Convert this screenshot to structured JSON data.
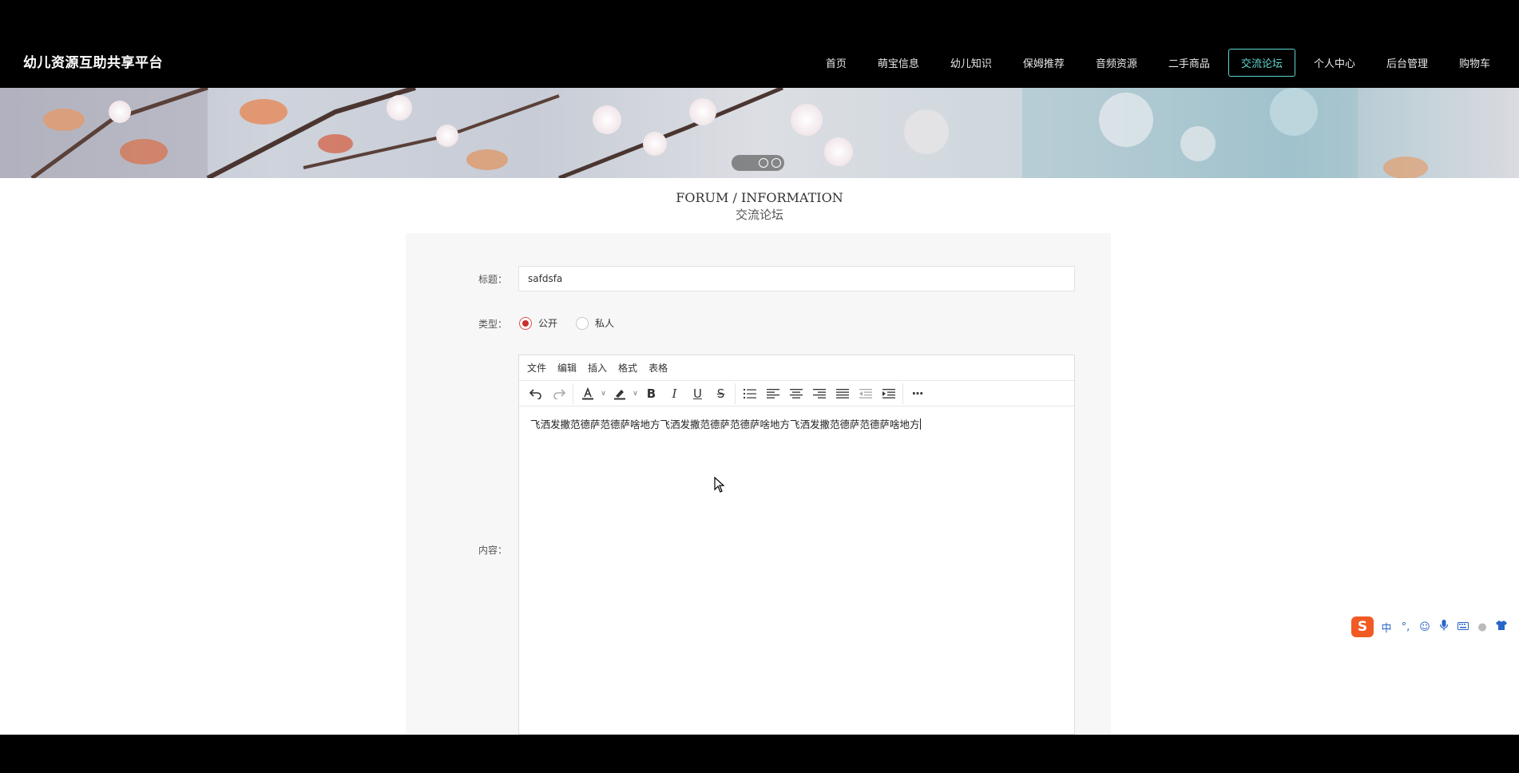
{
  "brand": "幼儿资源互助共享平台",
  "nav": [
    {
      "label": "首页",
      "active": false
    },
    {
      "label": "萌宝信息",
      "active": false
    },
    {
      "label": "幼儿知识",
      "active": false
    },
    {
      "label": "保姆推荐",
      "active": false
    },
    {
      "label": "音频资源",
      "active": false
    },
    {
      "label": "二手商品",
      "active": false
    },
    {
      "label": "交流论坛",
      "active": true
    },
    {
      "label": "个人中心",
      "active": false
    },
    {
      "label": "后台管理",
      "active": false
    },
    {
      "label": "购物车",
      "active": false
    }
  ],
  "section": {
    "title_en": "FORUM / INFORMATION",
    "title_cn": "交流论坛"
  },
  "form": {
    "title_label": "标题：",
    "title_value": "safdsfa",
    "type_label": "类型：",
    "type_options": [
      {
        "label": "公开",
        "checked": true
      },
      {
        "label": "私人",
        "checked": false
      }
    ],
    "content_label": "内容："
  },
  "editor": {
    "menus": [
      "文件",
      "编辑",
      "插入",
      "格式",
      "表格"
    ],
    "toolbar": {
      "undo": "undo-icon",
      "redo": "redo-icon",
      "text_color": "text-color-icon",
      "highlight": "highlight-icon",
      "bold": "B",
      "italic": "I",
      "underline": "U",
      "strike": "S",
      "list": "bullet-list-icon",
      "align_left": "align-left-icon",
      "align_center": "align-center-icon",
      "align_right": "align-right-icon",
      "align_justify": "align-justify-icon",
      "outdent": "outdent-icon",
      "indent": "indent-icon",
      "more": "···"
    },
    "content": "飞洒发撒范德萨范德萨啥地方飞洒发撒范德萨范德萨啥地方飞洒发撒范德萨范德萨啥地方"
  },
  "ime": {
    "lang": "中",
    "punct": "°,"
  },
  "colors": {
    "accent": "#5fd6d0",
    "radio_checked": "#c9302c",
    "ime_logo": "#f25a23"
  }
}
